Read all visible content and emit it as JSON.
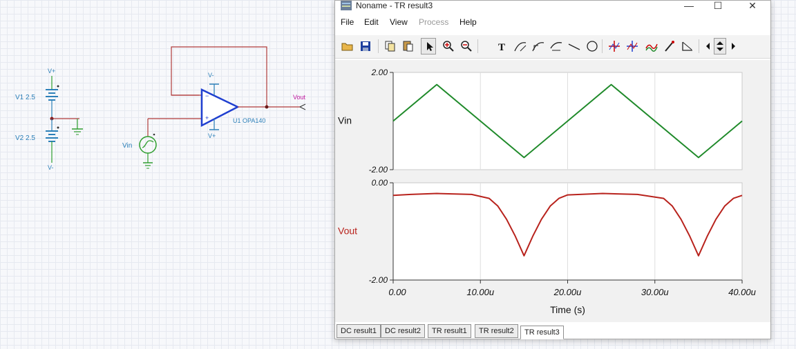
{
  "schematic": {
    "v1_label": "V1 2.5",
    "v2_label": "V2 2.5",
    "vplus_top": "V+",
    "vminus_bottom": "V-",
    "vin_label": "Vin",
    "opamp_label": "U1 OPA140",
    "opamp_vminus": "V-",
    "opamp_vplus": "V+",
    "vout_label": "Vout",
    "colors": {
      "wire": "#b03a3a",
      "ground": "#2e9e2e",
      "component": "#2b7fb8",
      "opamp": "#1f3fd0",
      "vout": "#c0169e"
    }
  },
  "window": {
    "title": "Noname - TR result3",
    "controls": {
      "minimize": "—",
      "maximize": "☐",
      "close": "✕"
    },
    "menu": [
      {
        "label": "File",
        "enabled": true
      },
      {
        "label": "Edit",
        "enabled": true
      },
      {
        "label": "View",
        "enabled": true
      },
      {
        "label": "Process",
        "enabled": false
      },
      {
        "label": "Help",
        "enabled": true
      }
    ],
    "toolbar_icons": [
      "open-folder-icon",
      "save-icon",
      "copy-icon",
      "paste-icon",
      "pointer-icon",
      "zoom-in-icon",
      "zoom-out-icon",
      "text-tool-icon",
      "curve-tool-1-icon",
      "curve-tool-2-icon",
      "curve-tool-3-icon",
      "line-tool-icon",
      "circle-tool-icon",
      "cursor-a-icon",
      "cursor-b-icon",
      "waveform-icon",
      "probe-icon",
      "angle-icon",
      "scroll-left-icon",
      "scroll-updown-icon",
      "scroll-right-icon"
    ],
    "tabs": [
      {
        "label": "DC result1",
        "active": false
      },
      {
        "label": "DC result2",
        "active": false
      },
      {
        "label": "TR result1",
        "active": false
      },
      {
        "label": "TR result2",
        "active": false
      },
      {
        "label": "TR result3",
        "active": true
      }
    ]
  },
  "chart_data": [
    {
      "type": "line",
      "ylabel": "Vin",
      "ylim": [
        -2.0,
        2.0
      ],
      "ytick_labels": [
        "2.00",
        "-2.00"
      ],
      "xlim": [
        0,
        40
      ],
      "grid": true,
      "color": "#1f8a2a",
      "series": [
        {
          "x": [
            0,
            5,
            15,
            25,
            35,
            40
          ],
          "values": [
            0.0,
            1.5,
            -1.5,
            1.5,
            -1.5,
            0.0
          ]
        }
      ]
    },
    {
      "type": "line",
      "ylabel": "Vout",
      "ylim": [
        -2.0,
        0.0
      ],
      "ytick_labels": [
        "0.00",
        "-2.00"
      ],
      "xlim": [
        0,
        40
      ],
      "xlabel": "Time (s)",
      "xtick_labels": [
        "0.00",
        "10.00u",
        "20.00u",
        "30.00u",
        "40.00u"
      ],
      "grid": true,
      "color": "#b8221c",
      "series": [
        {
          "x": [
            0,
            2,
            5,
            9,
            11,
            12,
            13,
            14,
            15,
            16,
            17,
            18,
            19,
            20,
            24,
            28,
            31,
            32,
            33,
            34,
            35,
            36,
            37,
            38,
            39,
            40
          ],
          "values": [
            -0.26,
            -0.24,
            -0.22,
            -0.24,
            -0.32,
            -0.48,
            -0.75,
            -1.1,
            -1.5,
            -1.1,
            -0.75,
            -0.48,
            -0.32,
            -0.25,
            -0.22,
            -0.24,
            -0.32,
            -0.48,
            -0.75,
            -1.1,
            -1.5,
            -1.1,
            -0.75,
            -0.48,
            -0.32,
            -0.26
          ]
        }
      ]
    }
  ]
}
